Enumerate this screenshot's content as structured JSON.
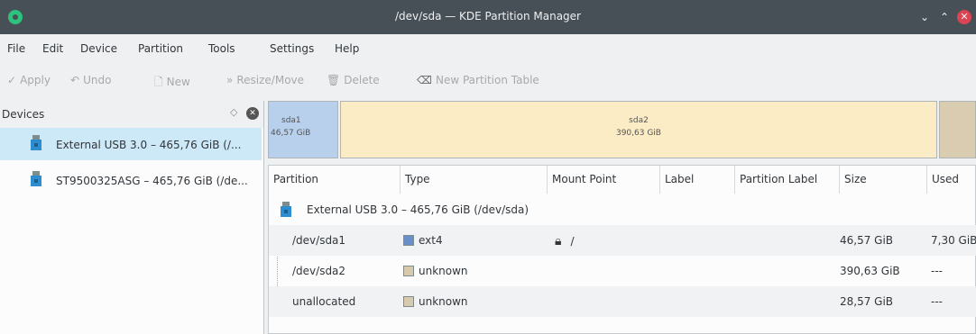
{
  "window": {
    "title": "/dev/sda — KDE Partition Manager"
  },
  "menu": [
    "File",
    "Edit",
    "Device",
    "Partition",
    "Tools",
    "Settings",
    "Help"
  ],
  "toolbar": {
    "apply": "Apply",
    "undo": "Undo",
    "new": "New",
    "resize": "Resize/Move",
    "delete": "Delete",
    "new_table": "New Partition Table"
  },
  "devices": {
    "header": "Devices",
    "items": [
      {
        "label": "External USB 3.0 – 465,76 GiB (/..."
      },
      {
        "label": "ST9500325ASG – 465,76 GiB (/de..."
      }
    ]
  },
  "partition_bar": [
    {
      "name": "sda1",
      "size": "46,57 GiB",
      "color": "#b9d0ec"
    },
    {
      "name": "sda2",
      "size": "390,63 GiB",
      "color": "#fbecc6"
    },
    {
      "name": "",
      "size": "",
      "color": "#d9ccb0"
    }
  ],
  "table": {
    "headers": [
      "Partition",
      "Type",
      "Mount Point",
      "Label",
      "Partition Label",
      "Size",
      "Used"
    ],
    "device_row": "External USB 3.0 – 465,76 GiB (/dev/sda)",
    "rows": [
      {
        "partition": "/dev/sda1",
        "type": "ext4",
        "type_color": "#6a8ec8",
        "mount": "/",
        "size": "46,57 GiB",
        "used": "7,30 GiB"
      },
      {
        "partition": "/dev/sda2",
        "type": "unknown",
        "type_color": "#d6c9ae",
        "mount": "",
        "size": "390,63 GiB",
        "used": "---"
      },
      {
        "partition": "unallocated",
        "type": "unknown",
        "type_color": "#d6c9ae",
        "mount": "",
        "size": "28,57 GiB",
        "used": "---"
      }
    ]
  }
}
